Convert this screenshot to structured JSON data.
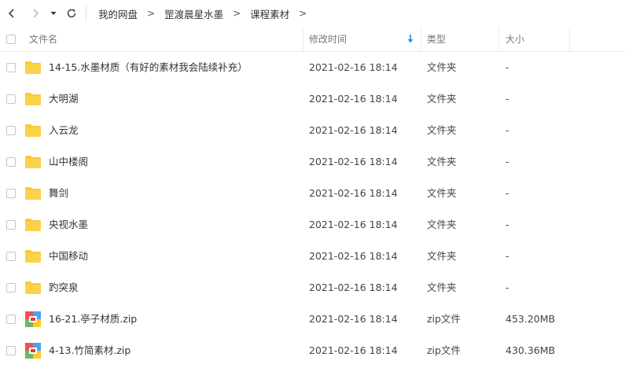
{
  "nav": {
    "back_icon": "chevron-left-icon",
    "forward_icon": "chevron-right-icon",
    "history_icon": "caret-down-icon",
    "refresh_icon": "refresh-icon"
  },
  "breadcrumb": [
    "我的网盘",
    "罡渡晨星水墨",
    "课程素材"
  ],
  "columns": {
    "name": "文件名",
    "modified": "修改时间",
    "type": "类型",
    "size": "大小"
  },
  "sort": {
    "column": "modified",
    "direction": "down",
    "color": "#1e88e5"
  },
  "colors": {
    "folder": "#f9c93b",
    "accent": "#1e88e5"
  },
  "files": [
    {
      "name": "14-15.水墨材质（有好的素材我会陆续补充）",
      "modified": "2021-02-16 18:14",
      "type": "文件夹",
      "size": "-",
      "icon": "folder-icon"
    },
    {
      "name": "大明湖",
      "modified": "2021-02-16 18:14",
      "type": "文件夹",
      "size": "-",
      "icon": "folder-icon"
    },
    {
      "name": "入云龙",
      "modified": "2021-02-16 18:14",
      "type": "文件夹",
      "size": "-",
      "icon": "folder-icon"
    },
    {
      "name": "山中楼阁",
      "modified": "2021-02-16 18:14",
      "type": "文件夹",
      "size": "-",
      "icon": "folder-icon"
    },
    {
      "name": "舞剑",
      "modified": "2021-02-16 18:14",
      "type": "文件夹",
      "size": "-",
      "icon": "folder-icon"
    },
    {
      "name": "央视水墨",
      "modified": "2021-02-16 18:14",
      "type": "文件夹",
      "size": "-",
      "icon": "folder-icon"
    },
    {
      "name": "中国移动",
      "modified": "2021-02-16 18:14",
      "type": "文件夹",
      "size": "-",
      "icon": "folder-icon"
    },
    {
      "name": "趵突泉",
      "modified": "2021-02-16 18:14",
      "type": "文件夹",
      "size": "-",
      "icon": "folder-icon"
    },
    {
      "name": "16-21.亭子材质.zip",
      "modified": "2021-02-16 18:14",
      "type": "zip文件",
      "size": "453.20MB",
      "icon": "zip-archive-icon"
    },
    {
      "name": "4-13.竹简素材.zip",
      "modified": "2021-02-16 18:14",
      "type": "zip文件",
      "size": "430.36MB",
      "icon": "zip-archive-icon"
    }
  ]
}
